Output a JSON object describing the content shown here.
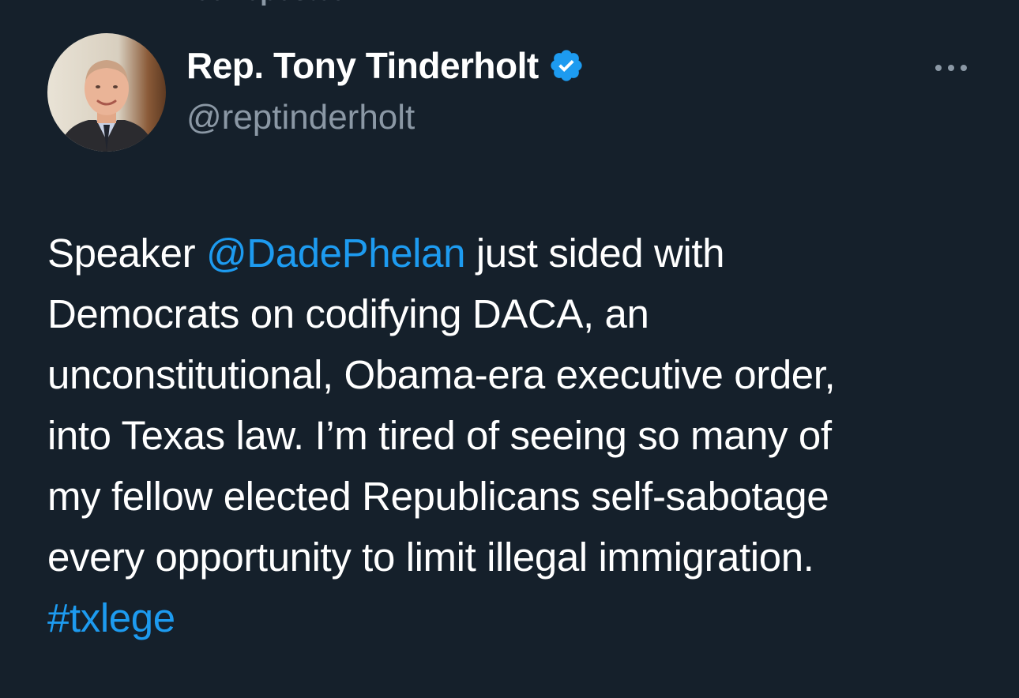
{
  "repost_header": {
    "label": "You reposted",
    "icon": "repost-icon"
  },
  "author": {
    "display_name": "Rep. Tony Tinderholt",
    "handle": "@reptinderholt",
    "verified": true,
    "verified_icon": "verified-badge-icon",
    "avatar": "author-avatar"
  },
  "menu": {
    "icon": "more-options-icon"
  },
  "tweet": {
    "line1_prefix": "Speaker ",
    "mention": "@DadePhelan",
    "line1_suffix": " just sided with",
    "line2": "Democrats on codifying DACA, an",
    "line3": "unconstitutional, Obama-era executive order,",
    "line4": "into Texas law. I’m tired of seeing so many of",
    "line5": "my fellow elected Republicans self-sabotage",
    "line6": "every opportunity to limit illegal immigration.",
    "hashtag": "#txlege"
  },
  "colors": {
    "background": "#15202b",
    "text": "#ffffff",
    "secondary_text": "#8b98a5",
    "link": "#1d9bf0",
    "verified": "#1d9bf0"
  }
}
